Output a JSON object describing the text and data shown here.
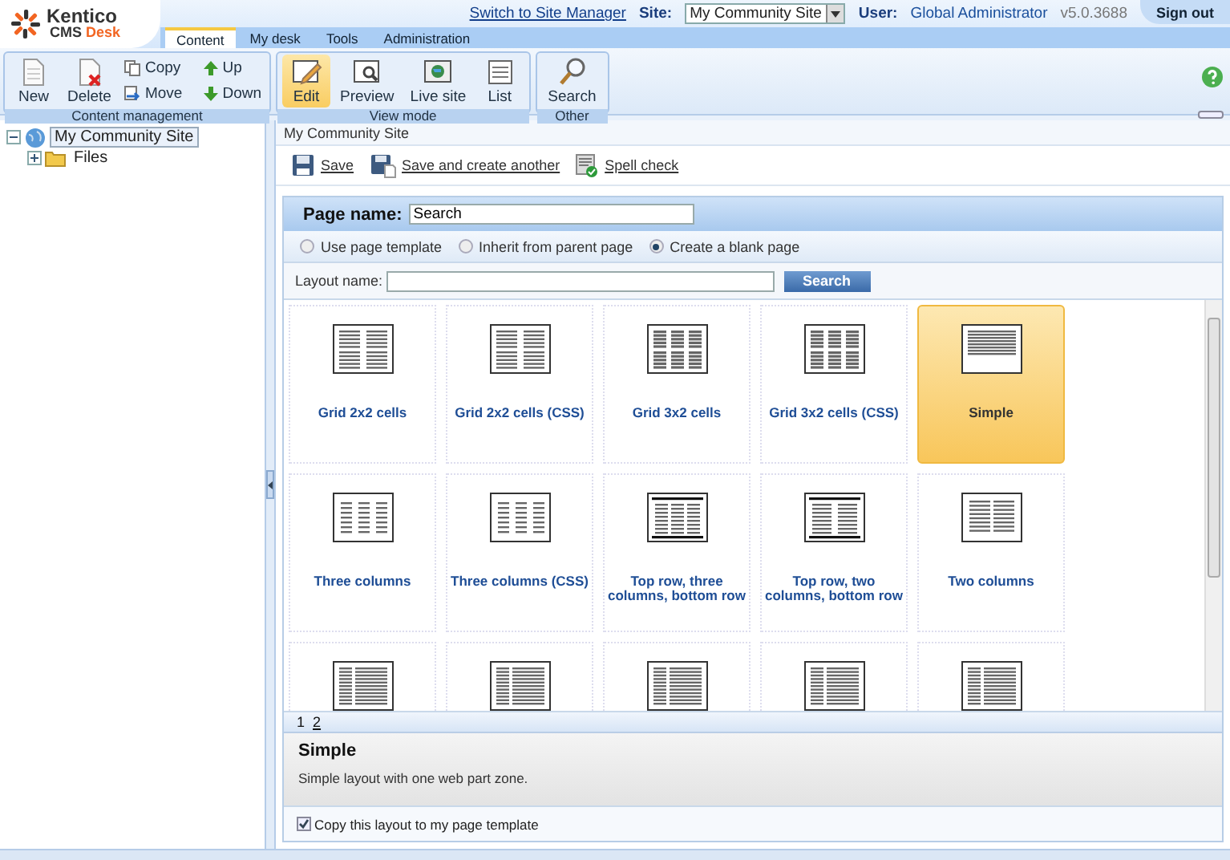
{
  "header": {
    "logo_name": "Kentico",
    "logo_product_prefix": "CMS",
    "logo_product": "Desk",
    "switch_link": "Switch to Site Manager",
    "site_label": "Site:",
    "site_value": "My Community Site",
    "user_label": "User:",
    "user_value": "Global Administrator",
    "version": "v5.0.3688",
    "sign_out": "Sign out"
  },
  "tabs": [
    {
      "label": "Content",
      "selected": true
    },
    {
      "label": "My desk",
      "selected": false
    },
    {
      "label": "Tools",
      "selected": false
    },
    {
      "label": "Administration",
      "selected": false
    }
  ],
  "toolbar": [
    {
      "title": "Content management",
      "large": [
        {
          "label": "New",
          "kind": "new",
          "selected": false
        },
        {
          "label": "Delete",
          "kind": "delete",
          "selected": false
        }
      ],
      "small": [
        {
          "label": "Copy",
          "kind": "copy"
        },
        {
          "label": "Move",
          "kind": "move"
        },
        {
          "label": "Up",
          "kind": "up"
        },
        {
          "label": "Down",
          "kind": "down"
        }
      ]
    },
    {
      "title": "View mode",
      "large": [
        {
          "label": "Edit",
          "kind": "edit",
          "selected": true
        },
        {
          "label": "Preview",
          "kind": "preview",
          "selected": false
        },
        {
          "label": "Live site",
          "kind": "live",
          "selected": false
        },
        {
          "label": "List",
          "kind": "list",
          "selected": false
        }
      ]
    },
    {
      "title": "Other",
      "large": [
        {
          "label": "Search",
          "kind": "search",
          "selected": false
        }
      ]
    }
  ],
  "tree": [
    {
      "label": "My Community Site",
      "kind": "site",
      "selected": true,
      "expanded": true,
      "children": [
        {
          "label": "Files",
          "kind": "folder",
          "selected": false,
          "expanded": false
        }
      ]
    }
  ],
  "breadcrumb": "My Community Site",
  "actions": [
    {
      "label": "Save",
      "kind": "save"
    },
    {
      "label": "Save and create another",
      "kind": "save_another"
    },
    {
      "label": "Spell check",
      "kind": "spell"
    }
  ],
  "page_name": {
    "label": "Page name:",
    "value": "Search"
  },
  "radios": [
    {
      "label": "Use page template",
      "selected": false
    },
    {
      "label": "Inherit from parent page",
      "selected": false
    },
    {
      "label": "Create a blank page",
      "selected": true
    }
  ],
  "layout_search": {
    "label": "Layout name:",
    "button": "Search"
  },
  "layouts": [
    {
      "name": "Grid 2x2 cells",
      "kind": "grid2x2",
      "selected": false
    },
    {
      "name": "Grid 2x2 cells (CSS)",
      "kind": "grid2x2",
      "selected": false
    },
    {
      "name": "Grid 3x2 cells",
      "kind": "grid3x2",
      "selected": false
    },
    {
      "name": "Grid 3x2 cells (CSS)",
      "kind": "grid3x2",
      "selected": false
    },
    {
      "name": "Simple",
      "kind": "simple",
      "selected": true
    },
    {
      "name": "Three columns",
      "kind": "three_columns",
      "selected": false
    },
    {
      "name": "Three columns (CSS)",
      "kind": "three_columns",
      "selected": false
    },
    {
      "name": "Top row, three columns, bottom row",
      "kind": "top_three_bottom",
      "selected": false
    },
    {
      "name": "Top row, two columns, bottom row",
      "kind": "top_two_bottom",
      "selected": false
    },
    {
      "name": "Two columns",
      "kind": "two_columns",
      "selected": false
    },
    {
      "kind": "two_columns_dense",
      "selected": false
    },
    {
      "kind": "two_columns_dense",
      "selected": false
    },
    {
      "kind": "two_columns_dense",
      "selected": false
    },
    {
      "kind": "two_columns_dense",
      "selected": false
    },
    {
      "kind": "two_columns_dense",
      "selected": false
    }
  ],
  "pager": [
    {
      "label": "1",
      "selected": true
    },
    {
      "label": "2",
      "selected": false
    }
  ],
  "description": {
    "title": "Simple",
    "text": "Simple layout with one web part zone."
  },
  "copy_option": {
    "label": "Copy this layout to my page template",
    "checked": true
  }
}
